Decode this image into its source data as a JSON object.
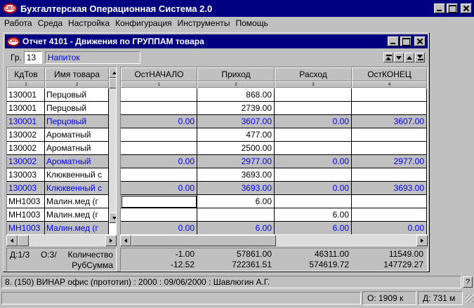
{
  "app": {
    "logo_text": "CBS",
    "title": "Бухгалтерская Операционная Система 2.0"
  },
  "menu": [
    "Работа",
    "Среда",
    "Настройка",
    "Конфигурация",
    "Инструменты",
    "Помощь"
  ],
  "report": {
    "logo_text": "CBS",
    "title": "Отчет 4101 - Движения по ГРУППАМ товара",
    "group_label": "Гр.",
    "group_code": "13",
    "group_name": "Напиток"
  },
  "left_table": {
    "columns": [
      {
        "label": "КдТов",
        "num": "1"
      },
      {
        "label": "Имя товара",
        "num": "2"
      }
    ],
    "rows": [
      {
        "code": "130001",
        "name": "Перцовый",
        "sum": false
      },
      {
        "code": "130001",
        "name": "Перцовый",
        "sum": false
      },
      {
        "code": "130001",
        "name": "Перцовый",
        "sum": true
      },
      {
        "code": "130002",
        "name": "Ароматный",
        "sum": false
      },
      {
        "code": "130002",
        "name": "Ароматный",
        "sum": false
      },
      {
        "code": "130002",
        "name": "Ароматный",
        "sum": true
      },
      {
        "code": "130003",
        "name": "Клюквенный с",
        "sum": false
      },
      {
        "code": "130003",
        "name": "Клюквенный с",
        "sum": true
      },
      {
        "code": "МН1003",
        "name": "Малин.мед (г",
        "sum": false
      },
      {
        "code": "МН1003",
        "name": "Малин.мед (г",
        "sum": false
      },
      {
        "code": "МН1003",
        "name": "Малин.мед (г",
        "sum": true
      }
    ]
  },
  "right_table": {
    "columns": [
      {
        "label": "ОстНАЧАЛО",
        "num": "1"
      },
      {
        "label": "Приход",
        "num": "2"
      },
      {
        "label": "Расход",
        "num": "3"
      },
      {
        "label": "ОстКОНЕЦ",
        "num": "4"
      }
    ],
    "rows": [
      [
        "",
        "868.00",
        "",
        ""
      ],
      [
        "",
        "2739.00",
        "",
        ""
      ],
      [
        "0.00",
        "3607.00",
        "0.00",
        "3607.00"
      ],
      [
        "",
        "477.00",
        "",
        ""
      ],
      [
        "",
        "2500.00",
        "",
        ""
      ],
      [
        "0.00",
        "2977.00",
        "0.00",
        "2977.00"
      ],
      [
        "",
        "3693.00",
        "",
        ""
      ],
      [
        "0.00",
        "3693.00",
        "0.00",
        "3693.00"
      ],
      [
        "",
        "6.00",
        "",
        ""
      ],
      [
        "",
        "",
        "6.00",
        ""
      ],
      [
        "0.00",
        "6.00",
        "6.00",
        "0.00"
      ]
    ]
  },
  "totals": {
    "info_d": "Д:1/3",
    "info_o": "О:3/",
    "label_qty": "Количество",
    "label_sum": "РубСумма",
    "qty": [
      "-1.00",
      "57861.00",
      "46311.00",
      "11549.00"
    ],
    "sum": [
      "-12.52",
      "722361.51",
      "574619.72",
      "147729.27"
    ]
  },
  "status": {
    "line": "8. (150) ВИНАР офис (прототип)  : 2000 : 09/06/2000 : Шавлюгин А.Г.",
    "help": "?",
    "o_value": "О:   1909 к",
    "d_value": "Д:   731 м"
  },
  "colors": {
    "title_bar": "#000080",
    "sum_text": "#0000ff",
    "face": "#c0c0c0"
  }
}
